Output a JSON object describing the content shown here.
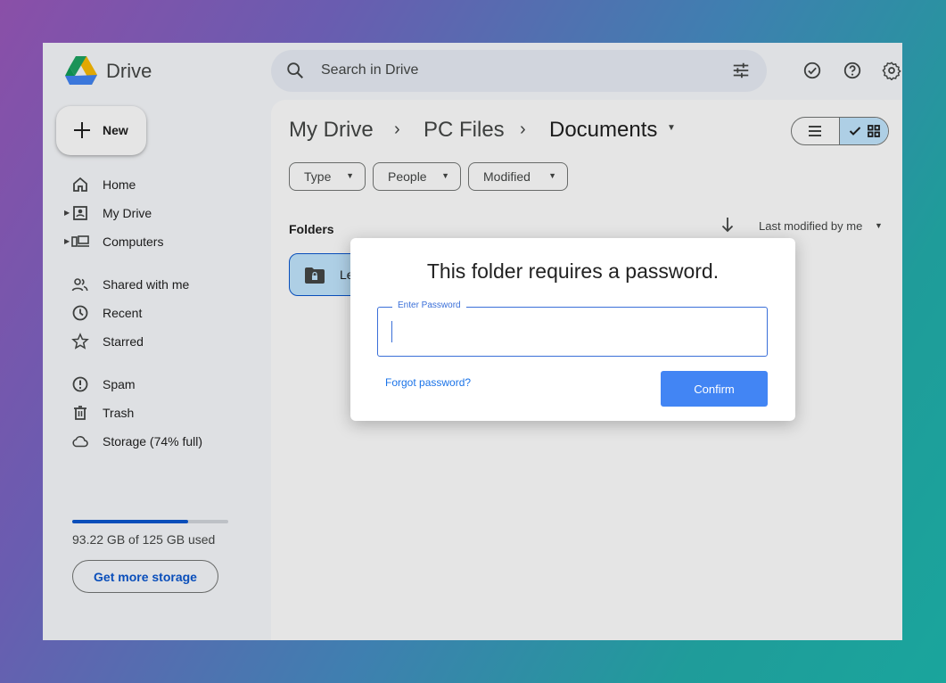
{
  "app": {
    "name": "Drive"
  },
  "search": {
    "placeholder": "Search in Drive"
  },
  "topbar_icons": [
    "offline-ready-icon",
    "help-icon",
    "settings-icon"
  ],
  "sidebar": {
    "new_label": "New",
    "items": [
      {
        "label": "Home",
        "icon": "home-icon"
      },
      {
        "label": "My Drive",
        "icon": "my-drive-icon",
        "expandable": true
      },
      {
        "label": "Computers",
        "icon": "computers-icon",
        "expandable": true
      },
      {
        "label": "Shared with me",
        "icon": "shared-icon"
      },
      {
        "label": "Recent",
        "icon": "clock-icon"
      },
      {
        "label": "Starred",
        "icon": "star-icon"
      },
      {
        "label": "Spam",
        "icon": "spam-icon"
      },
      {
        "label": "Trash",
        "icon": "trash-icon"
      },
      {
        "label": "Storage (74% full)",
        "icon": "cloud-icon"
      }
    ],
    "storage": {
      "used_text": "93.22 GB of 125 GB used",
      "percent": 74,
      "button": "Get more storage"
    }
  },
  "main": {
    "breadcrumb": [
      "My Drive",
      "PC Files",
      "Documents"
    ],
    "filters": [
      "Type",
      "People",
      "Modified"
    ],
    "section_title": "Folders",
    "sort_label": "Last modified by me",
    "folder": {
      "name": "Le"
    }
  },
  "dialog": {
    "title": "This folder requires a password.",
    "field_label": "Enter Password",
    "forgot_label": "Forgot password?",
    "confirm_label": "Confirm"
  },
  "colors": {
    "accent": "#0b57d0",
    "confirm": "#4285f4",
    "selected": "#c2e7ff"
  }
}
